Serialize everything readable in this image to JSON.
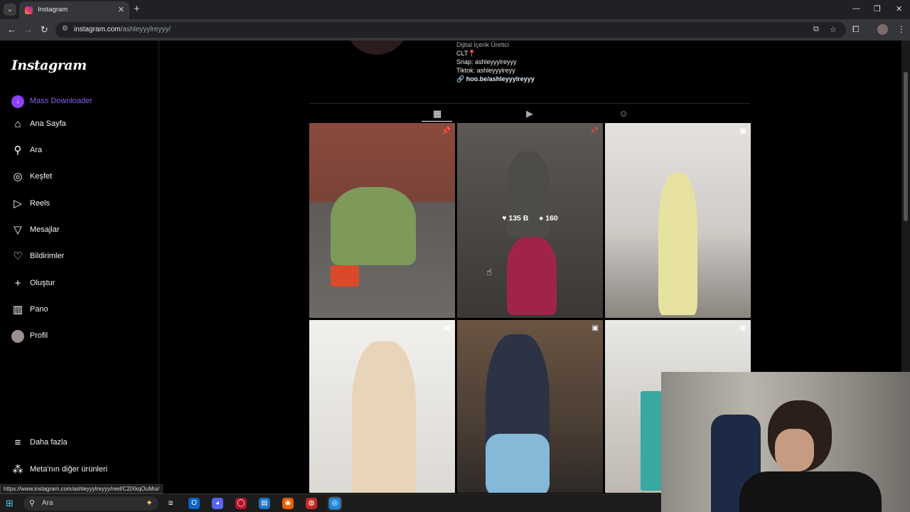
{
  "browser": {
    "tab_title": "Instagram",
    "tab_close": "✕",
    "new_tab": "+",
    "url_host": "instagram.com",
    "url_path": "/ashleyyylreyyy/",
    "status_url": "https://www.instagram.com/ashleyyylreyyy/reel/C2lXkqOuMoi/"
  },
  "sidebar": {
    "logo": "Instagram",
    "items": [
      {
        "label": "Mass Downloader",
        "icon": "download-icon"
      },
      {
        "label": "Ana Sayfa",
        "icon": "home-icon"
      },
      {
        "label": "Ara",
        "icon": "search-icon"
      },
      {
        "label": "Keşfet",
        "icon": "compass-icon"
      },
      {
        "label": "Reels",
        "icon": "reels-icon"
      },
      {
        "label": "Mesajlar",
        "icon": "messages-icon"
      },
      {
        "label": "Bildirimler",
        "icon": "heart-icon"
      },
      {
        "label": "Oluştur",
        "icon": "plus-icon"
      },
      {
        "label": "Pano",
        "icon": "dashboard-icon"
      },
      {
        "label": "Profil",
        "icon": "avatar"
      }
    ],
    "more": "Daha fazla",
    "meta": "Meta'nın diğer ürünleri"
  },
  "profile": {
    "bio_category": "Dijital İçerik Üretici",
    "bio_lines": [
      "CLT📍",
      "Snap: ashleyyylreyyy",
      "Tiktok: ashleyyylreyy"
    ],
    "bio_link": "hoo.be/ashleyyylreyyy"
  },
  "posts": [
    {
      "type": "pinned"
    },
    {
      "type": "pinned",
      "likes": "135 B",
      "comments": "160"
    },
    {
      "type": "reel"
    },
    {
      "type": "reel"
    },
    {
      "type": "reel"
    },
    {
      "type": "reel"
    }
  ],
  "taskbar": {
    "search_placeholder": "Ara"
  },
  "colors": {
    "accent": "#8a3ffc",
    "background": "#000000"
  }
}
